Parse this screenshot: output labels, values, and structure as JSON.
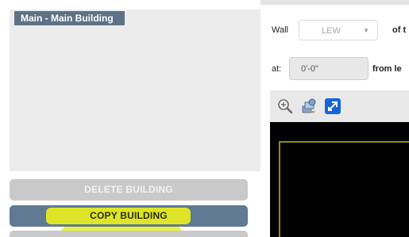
{
  "building_list": {
    "items": [
      {
        "label": "Main - Main Building",
        "selected": true
      }
    ]
  },
  "actions": {
    "delete_label": "DELETE BUILDING",
    "copy_label": "COPY BUILDING"
  },
  "wall_form": {
    "wall_label": "Wall",
    "wall_value": "LEW",
    "of_label": "of t",
    "at_label": "at:",
    "at_value": "0'-0\"",
    "from_label": "from le"
  },
  "toolbar": {
    "icons": [
      "zoom-icon",
      "layers-icon",
      "expand-icon"
    ]
  },
  "colors": {
    "selected_item": "#5d7286",
    "copy_button": "#5f7a92",
    "delete_button": "#c9c9c9",
    "highlight": "#e9ee1f",
    "canvas_bg": "#000000",
    "canvas_outline": "#8d8a1c",
    "expand_icon": "#1565d8"
  }
}
